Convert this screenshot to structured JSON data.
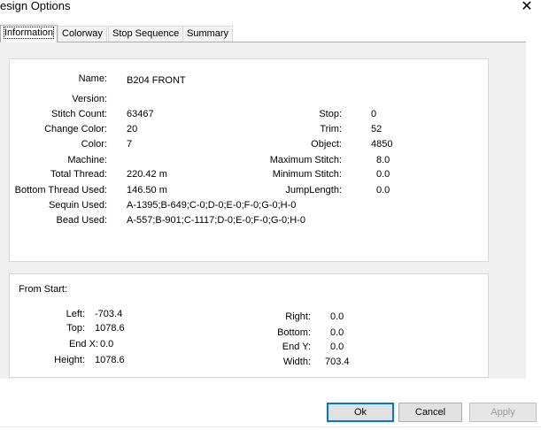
{
  "window": {
    "title": "esign Options",
    "close_glyph": "✕"
  },
  "tabs": [
    "Information",
    "Colorway",
    "Stop Sequence",
    "Summary"
  ],
  "info": {
    "name_label": "Name:",
    "name_value": "B204 FRONT",
    "version_label": "Version:",
    "version_value": "",
    "stitch_count_label": "Stitch Count:",
    "stitch_count_value": "63467",
    "change_color_label": "Change Color:",
    "change_color_value": "20",
    "color_label": "Color:",
    "color_value": "7",
    "machine_label": "Machine:",
    "machine_value": "",
    "total_thread_label": "Total Thread:",
    "total_thread_value": "220.42 m",
    "bottom_thread_label": "Bottom Thread Used:",
    "bottom_thread_value": "146.50 m",
    "sequin_label": "Sequin Used:",
    "sequin_value": "A-1395;B-649;C-0;D-0;E-0;F-0;G-0;H-0",
    "bead_label": "Bead Used:",
    "bead_value": "A-557;B-901;C-1117;D-0;E-0;F-0;G-0;H-0",
    "stop_label": "Stop:",
    "stop_value": "0",
    "trim_label": "Trim:",
    "trim_value": "52",
    "object_label": "Object:",
    "object_value": "4850",
    "max_stitch_label": "Maximum Stitch:",
    "max_stitch_value": "8.0",
    "min_stitch_label": "Minimum Stitch:",
    "min_stitch_value": "0.0",
    "jump_length_label": "JumpLength:",
    "jump_length_value": "0.0"
  },
  "from_start": {
    "title": "From Start:",
    "left_label": "Left:",
    "left_value": "-703.4",
    "top_label": "Top:",
    "top_value": "1078.6",
    "endx_label": "End X:",
    "endx_value": "0.0",
    "height_label": "Height:",
    "height_value": "1078.6",
    "right_label": "Right:",
    "right_value": "0.0",
    "bottom_label": "Bottom:",
    "bottom_value": "0.0",
    "endy_label": "End Y:",
    "endy_value": "0.0",
    "width_label": "Width:",
    "width_value": "703.4"
  },
  "buttons": {
    "ok": "Ok",
    "cancel": "Cancel",
    "apply": "Apply"
  }
}
